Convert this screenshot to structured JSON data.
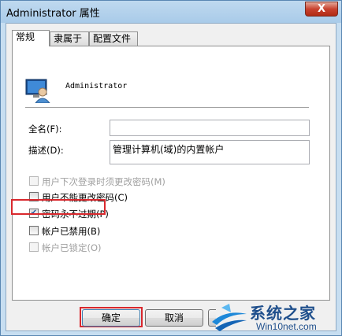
{
  "window": {
    "title": "Administrator 属性",
    "close_label": "X"
  },
  "tabs": [
    {
      "label": "常规",
      "active": true
    },
    {
      "label": "隶属于",
      "active": false
    },
    {
      "label": "配置文件",
      "active": false
    }
  ],
  "user": {
    "name": "Administrator",
    "icon": "user-computer-icon"
  },
  "fields": {
    "full_name": {
      "label": "全名(F):",
      "value": ""
    },
    "description": {
      "label": "描述(D):",
      "value": "管理计算机(域)的内置帐户"
    }
  },
  "checkboxes": [
    {
      "label": "用户下次登录时须更改密码(M)",
      "checked": false,
      "enabled": false
    },
    {
      "label": "用户不能更改密码(C)",
      "checked": false,
      "enabled": true
    },
    {
      "label": "密码永不过期(P)",
      "checked": true,
      "enabled": true
    },
    {
      "label": "帐户已禁用(B)",
      "checked": false,
      "enabled": true,
      "highlighted": true
    },
    {
      "label": "帐户已锁定(O)",
      "checked": false,
      "enabled": false
    }
  ],
  "buttons": {
    "ok": "确定",
    "cancel": "取消"
  },
  "watermark": {
    "text": "系统之家",
    "url": "Win10net.com"
  },
  "colors": {
    "highlight": "#d9282d",
    "title_close": "#c8422f"
  }
}
